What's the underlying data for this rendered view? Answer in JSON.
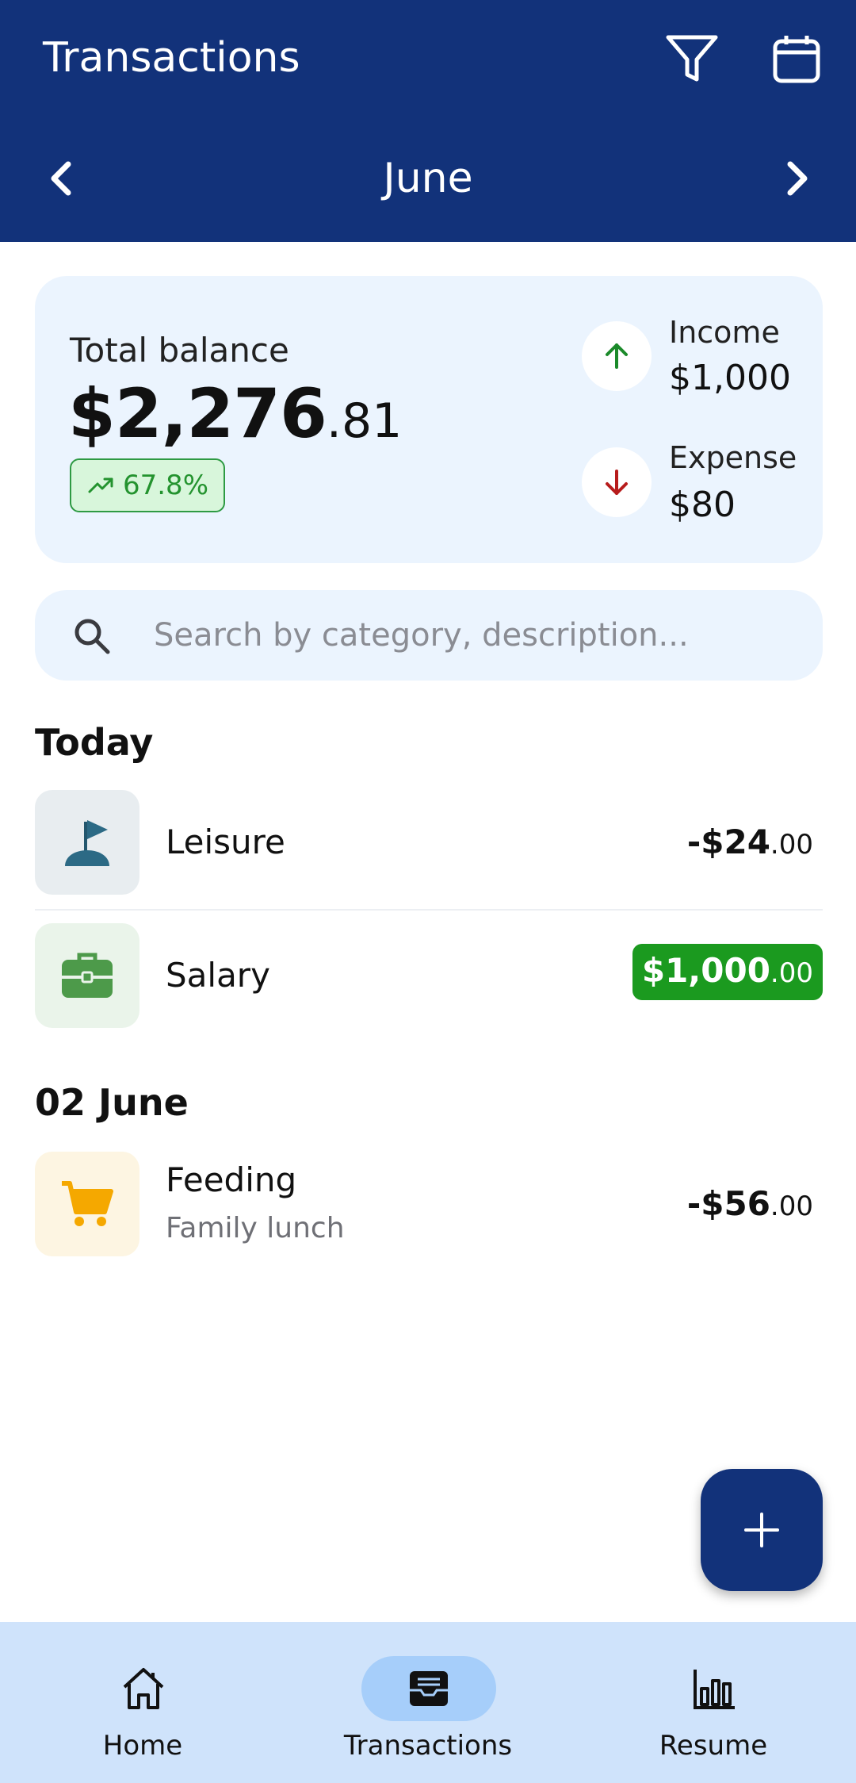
{
  "header": {
    "title": "Transactions",
    "month": "June",
    "icons": [
      "filter-icon",
      "calendar-icon",
      "chevron-left-icon",
      "chevron-right-icon"
    ]
  },
  "balance": {
    "label": "Total balance",
    "amount_int": "$2,276",
    "amount_dec": ".81",
    "change": "67.8%",
    "income_label": "Income",
    "income_value": "$1,000",
    "expense_label": "Expense",
    "expense_value": "$80"
  },
  "search": {
    "placeholder": "Search by category, description..."
  },
  "sections": [
    {
      "title": "Today",
      "items": [
        {
          "name": "Leisure",
          "description": "",
          "amount_int": "-$24",
          "amount_dec": ".00",
          "icon": "flag-icon"
        },
        {
          "name": "Salary",
          "description": "",
          "amount_int": "$1,000",
          "amount_dec": ".00",
          "icon": "briefcase-icon"
        }
      ]
    },
    {
      "title": "02 June",
      "items": [
        {
          "name": "Feeding",
          "description": "Family lunch",
          "amount_int": "-$56",
          "amount_dec": ".00",
          "icon": "cart-icon"
        }
      ]
    }
  ],
  "bottom_nav": {
    "items": [
      {
        "label": "Home",
        "icon": "home-icon"
      },
      {
        "label": "Transactions",
        "icon": "inbox-icon",
        "active": true
      },
      {
        "label": "Resume",
        "icon": "bar-chart-icon"
      }
    ]
  },
  "colors": {
    "primary": "#12327a",
    "income": "#1b9a1f",
    "expense": "#b71c1c",
    "card_bg": "#ebf4fe",
    "nav_bg": "#cfe3fb"
  }
}
